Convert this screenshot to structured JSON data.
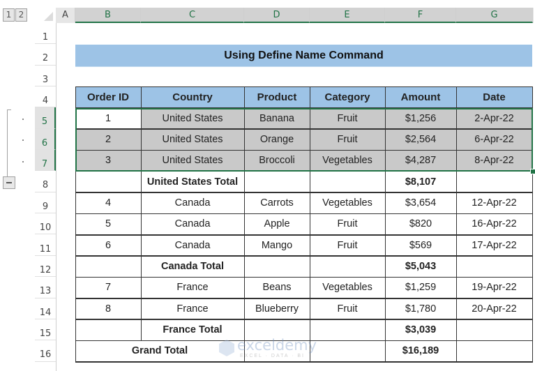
{
  "outline": {
    "levels": [
      "1",
      "2"
    ],
    "collapse_symbol": "−"
  },
  "columns": [
    "A",
    "B",
    "C",
    "D",
    "E",
    "F",
    "G"
  ],
  "rows": [
    "1",
    "2",
    "3",
    "4",
    "5",
    "6",
    "7",
    "8",
    "9",
    "10",
    "11",
    "12",
    "13",
    "14",
    "15",
    "16"
  ],
  "title": "Using Define Name Command",
  "table": {
    "headers": [
      "Order ID",
      "Country",
      "Product",
      "Category",
      "Amount",
      "Date"
    ],
    "rows": [
      {
        "type": "data",
        "cells": [
          "1",
          "United States",
          "Banana",
          "Fruit",
          "$1,256",
          "2-Apr-22"
        ]
      },
      {
        "type": "data",
        "cells": [
          "2",
          "United States",
          "Orange",
          "Fruit",
          "$2,564",
          "6-Apr-22"
        ]
      },
      {
        "type": "data",
        "cells": [
          "3",
          "United States",
          "Broccoli",
          "Vegetables",
          "$4,287",
          "8-Apr-22"
        ]
      },
      {
        "type": "subtotal",
        "cells": [
          "",
          "United States Total",
          "",
          "",
          "$8,107",
          ""
        ]
      },
      {
        "type": "data",
        "cells": [
          "4",
          "Canada",
          "Carrots",
          "Vegetables",
          "$3,654",
          "12-Apr-22"
        ]
      },
      {
        "type": "data",
        "cells": [
          "5",
          "Canada",
          "Apple",
          "Fruit",
          "$820",
          "16-Apr-22"
        ]
      },
      {
        "type": "data",
        "cells": [
          "6",
          "Canada",
          "Mango",
          "Fruit",
          "$569",
          "17-Apr-22"
        ]
      },
      {
        "type": "subtotal",
        "cells": [
          "",
          "Canada  Total",
          "",
          "",
          "$5,043",
          ""
        ]
      },
      {
        "type": "data",
        "cells": [
          "7",
          "France",
          "Beans",
          "Vegetables",
          "$1,259",
          "19-Apr-22"
        ]
      },
      {
        "type": "data",
        "cells": [
          "8",
          "France",
          "Blueberry",
          "Fruit",
          "$1,780",
          "20-Apr-22"
        ]
      },
      {
        "type": "subtotal",
        "cells": [
          "",
          "France  Total",
          "",
          "",
          "$3,039",
          ""
        ]
      },
      {
        "type": "grand",
        "cells": [
          "Grand Total",
          "",
          "",
          "$16,189",
          ""
        ]
      }
    ]
  },
  "selection": {
    "range": "B5:G7"
  },
  "colors": {
    "header_fill": "#9dc3e6",
    "selected_fill": "#c9c9c9",
    "excel_green": "#217346"
  },
  "watermark": {
    "name": "exceldemy",
    "tagline": "EXCEL · DATA · BI"
  }
}
